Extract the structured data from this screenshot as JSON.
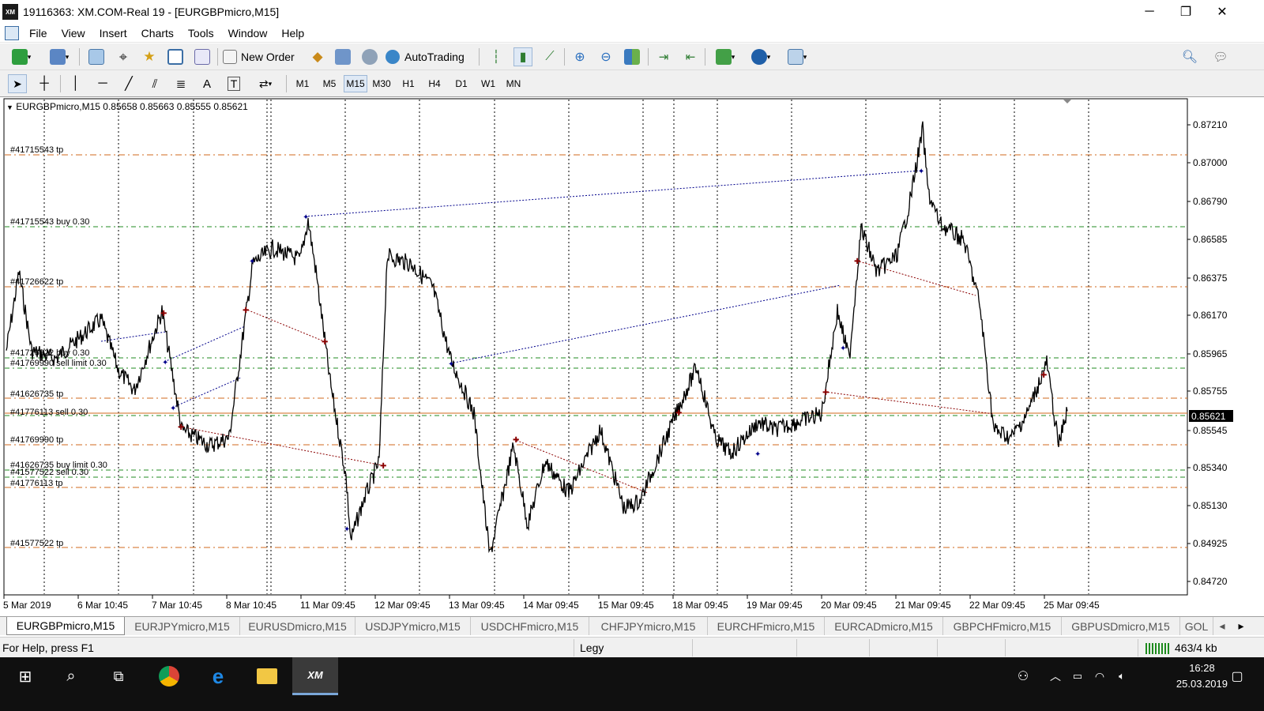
{
  "window": {
    "title": "19116363: XM.COM-Real 19 - [EURGBPmicro,M15]",
    "app_icon_text": "XM"
  },
  "window_controls": {
    "minimize": "─",
    "restore": "❐",
    "close": "✕"
  },
  "menu": [
    "File",
    "View",
    "Insert",
    "Charts",
    "Tools",
    "Window",
    "Help"
  ],
  "mdi_controls": {
    "minimize": "–",
    "restore": "❐",
    "close": "✕"
  },
  "toolbar": {
    "new_order": "New Order",
    "auto_trading": "AutoTrading"
  },
  "timeframes": [
    "M1",
    "M5",
    "M15",
    "M30",
    "H1",
    "H4",
    "D1",
    "W1",
    "MN"
  ],
  "active_timeframe": "M15",
  "chart": {
    "symbol_info": "EURGBPmicro,M15  0.85658 0.85663 0.85555 0.85621",
    "current_price": "0.85621",
    "price_labels": [
      "0.87210",
      "0.87000",
      "0.86790",
      "0.86585",
      "0.86375",
      "0.86170",
      "0.85965",
      "0.85755",
      "0.85545",
      "0.85340",
      "0.85130",
      "0.84925",
      "0.84720"
    ],
    "time_labels": [
      "5 Mar 2019",
      "6 Mar 10:45",
      "7 Mar 10:45",
      "8 Mar 10:45",
      "11 Mar 09:45",
      "12 Mar 09:45",
      "13 Mar 09:45",
      "14 Mar 09:45",
      "15 Mar 09:45",
      "18 Mar 09:45",
      "19 Mar 09:45",
      "20 Mar 09:45",
      "21 Mar 09:45",
      "22 Mar 09:45",
      "25 Mar 09:45"
    ],
    "order_labels": [
      "#41715543 tp",
      "#41715543 buy 0.30",
      "#41726622 tp",
      "#41726622 buy 0.30",
      "#41769990 sell limit 0.30",
      "#41626735 tp",
      "#41776113 sell 0.30",
      "#41769990 tp",
      "#41626735 buy limit 0.30",
      "#41577522 sell 0.30",
      "#41776113 tp",
      "#41577522 tp"
    ],
    "colors": {
      "tp_line": "#d2691e",
      "order_line": "#228b22",
      "price_line": "#000000",
      "bid_line": "#8b0000",
      "buy_trade": "#00008b",
      "sell_trade": "#8b0000"
    }
  },
  "tabs": [
    "EURGBPmicro,M15",
    "EURJPYmicro,M15",
    "EURUSDmicro,M15",
    "USDJPYmicro,M15",
    "USDCHFmicro,M15",
    "CHFJPYmicro,M15",
    "EURCHFmicro,M15",
    "EURCADmicro,M15",
    "GBPCHFmicro,M15",
    "GBPUSDmicro,M15",
    "GOL"
  ],
  "status": {
    "help": "For Help, press F1",
    "profile": "Legy",
    "traffic": "463/4 kb"
  },
  "taskbar": {
    "time": "16:28",
    "date": "25.03.2019",
    "pinned_app": "XM"
  }
}
